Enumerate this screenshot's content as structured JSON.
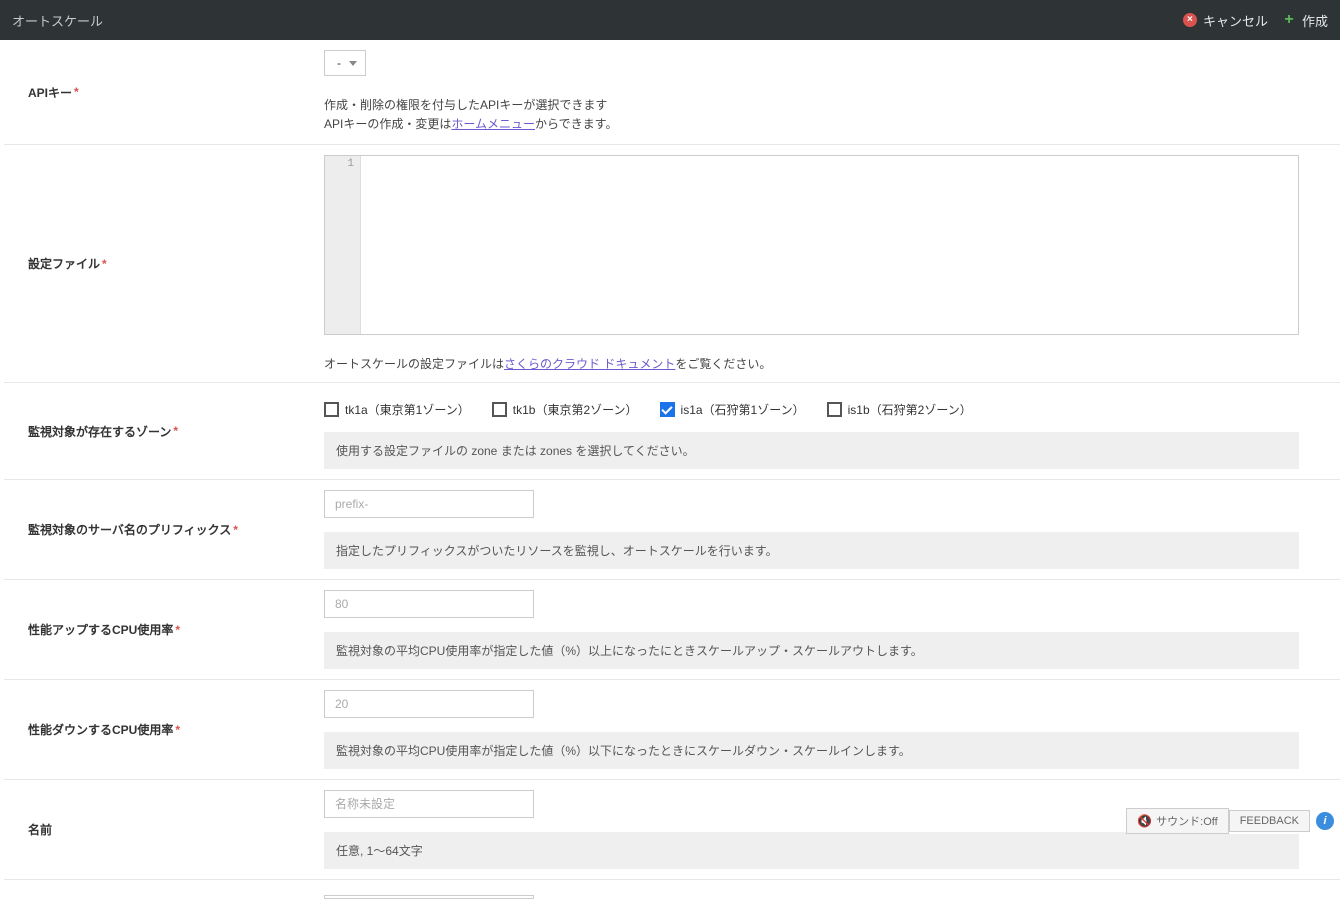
{
  "header": {
    "title": "オートスケール",
    "cancel": "キャンセル",
    "create": "作成"
  },
  "apikey": {
    "label": "APIキー",
    "select_value": "-",
    "help1": "作成・削除の権限を付与したAPIキーが選択できます",
    "help2a": "APIキーの作成・変更は",
    "help2_link": "ホームメニュー",
    "help2b": "からできます。"
  },
  "config": {
    "label": "設定ファイル",
    "gutter": "1",
    "help_a": "オートスケールの設定ファイルは",
    "help_link": "さくらのクラウド ドキュメント",
    "help_b": "をご覧ください。"
  },
  "zones": {
    "label": "監視対象が存在するゾーン",
    "items": [
      {
        "id": "tk1a",
        "label": "tk1a（東京第1ゾーン）",
        "checked": false
      },
      {
        "id": "tk1b",
        "label": "tk1b（東京第2ゾーン）",
        "checked": false
      },
      {
        "id": "is1a",
        "label": "is1a（石狩第1ゾーン）",
        "checked": true
      },
      {
        "id": "is1b",
        "label": "is1b（石狩第2ゾーン）",
        "checked": false
      }
    ],
    "info": "使用する設定ファイルの zone または zones を選択してください。"
  },
  "prefix": {
    "label": "監視対象のサーバ名のプリフィックス",
    "placeholder": "prefix-",
    "info": "指定したプリフィックスがついたリソースを監視し、オートスケールを行います。"
  },
  "cpu_up": {
    "label": "性能アップするCPU使用率",
    "placeholder": "80",
    "info": "監視対象の平均CPU使用率が指定した値（%）以上になったにときスケールアップ・スケールアウトします。"
  },
  "cpu_down": {
    "label": "性能ダウンするCPU使用率",
    "placeholder": "20",
    "info": "監視対象の平均CPU使用率が指定した値（%）以下になったときにスケールダウン・スケールインします。"
  },
  "name": {
    "label": "名前",
    "placeholder": "名称未設定",
    "info": "任意, 1〜64文字"
  },
  "footer": {
    "sound": "サウンド:Off",
    "feedback": "FEEDBACK"
  }
}
